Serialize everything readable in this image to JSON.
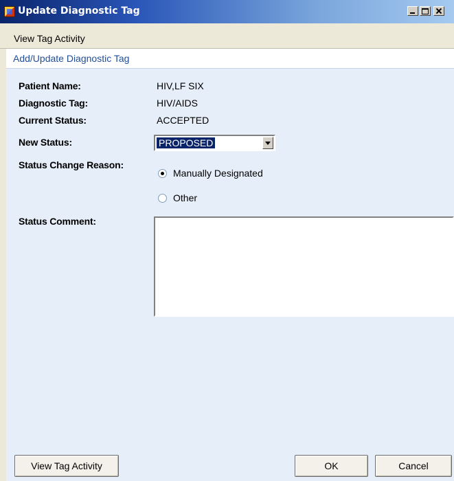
{
  "window": {
    "title": "Update Diagnostic Tag",
    "icon": "app-icon"
  },
  "menu": {
    "items": [
      {
        "label": "View Tag Activity"
      }
    ]
  },
  "section": {
    "title": "Add/Update Diagnostic Tag"
  },
  "fields": {
    "patient_name": {
      "label": "Patient Name:",
      "value": "HIV,LF SIX"
    },
    "diagnostic_tag": {
      "label": "Diagnostic Tag:",
      "value": "HIV/AIDS"
    },
    "current_status": {
      "label": "Current Status:",
      "value": "ACCEPTED"
    },
    "new_status": {
      "label": "New Status:",
      "value": "PROPOSED"
    },
    "status_change_reason": {
      "label": "Status Change Reason:",
      "options": [
        {
          "label": "Manually Designated",
          "checked": true
        },
        {
          "label": "Other",
          "checked": false
        }
      ]
    },
    "status_comment": {
      "label": "Status Comment:",
      "value": ""
    }
  },
  "buttons": {
    "view_tag_activity": "View Tag Activity",
    "ok": "OK",
    "cancel": "Cancel"
  },
  "colors": {
    "title_bar_start": "#0a246a",
    "title_bar_end": "#a6caf0",
    "client_background": "#e6eef9",
    "section_title": "#1f4e99",
    "selection": "#0a246a"
  }
}
